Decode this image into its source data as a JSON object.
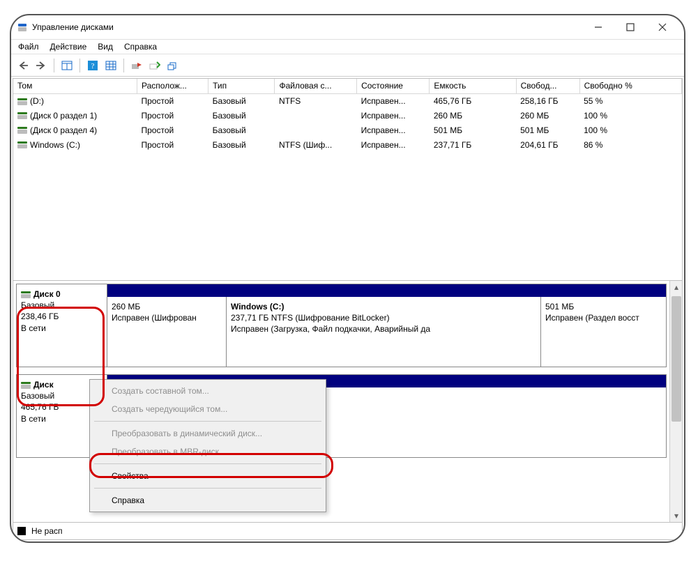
{
  "window": {
    "title": "Управление дисками"
  },
  "menubar": [
    "Файл",
    "Действие",
    "Вид",
    "Справка"
  ],
  "columns": [
    "Том",
    "Располож...",
    "Тип",
    "Файловая с...",
    "Состояние",
    "Емкость",
    "Свобод...",
    "Свободно %"
  ],
  "volumes": [
    {
      "name": "(D:)",
      "layout": "Простой",
      "type": "Базовый",
      "fs": "NTFS",
      "state": "Исправен...",
      "cap": "465,76 ГБ",
      "free": "258,16 ГБ",
      "pct": "55 %"
    },
    {
      "name": "(Диск 0 раздел 1)",
      "layout": "Простой",
      "type": "Базовый",
      "fs": "",
      "state": "Исправен...",
      "cap": "260 МБ",
      "free": "260 МБ",
      "pct": "100 %"
    },
    {
      "name": "(Диск 0 раздел 4)",
      "layout": "Простой",
      "type": "Базовый",
      "fs": "",
      "state": "Исправен...",
      "cap": "501 МБ",
      "free": "501 МБ",
      "pct": "100 %"
    },
    {
      "name": "Windows (C:)",
      "layout": "Простой",
      "type": "Базовый",
      "fs": "NTFS (Шиф...",
      "state": "Исправен...",
      "cap": "237,71 ГБ",
      "free": "204,61 ГБ",
      "pct": "86 %"
    }
  ],
  "disk0": {
    "name": "Диск 0",
    "type": "Базовый",
    "size": "238,46 ГБ",
    "status": "В сети",
    "parts": [
      {
        "title": "",
        "l1": "260 МБ",
        "l2": "Исправен (Шифрован"
      },
      {
        "title": "Windows  (C:)",
        "l1": "237,71 ГБ NTFS (Шифрование BitLocker)",
        "l2": "Исправен (Загрузка, Файл подкачки, Аварийный да"
      },
      {
        "title": "",
        "l1": "501 МБ",
        "l2": "Исправен (Раздел восст"
      }
    ]
  },
  "disk1": {
    "name": "Диск",
    "type": "Базовый",
    "size": "465,76 ГБ",
    "status": "В сети"
  },
  "ctx": {
    "i0": "Создать составной том...",
    "i1": "Создать чередующийся том...",
    "i2": "Преобразовать в динамический диск...",
    "i3": "Преобразовать в MBR-диск",
    "i4": "Свойства",
    "i5": "Справка"
  },
  "legend": "Не расп"
}
